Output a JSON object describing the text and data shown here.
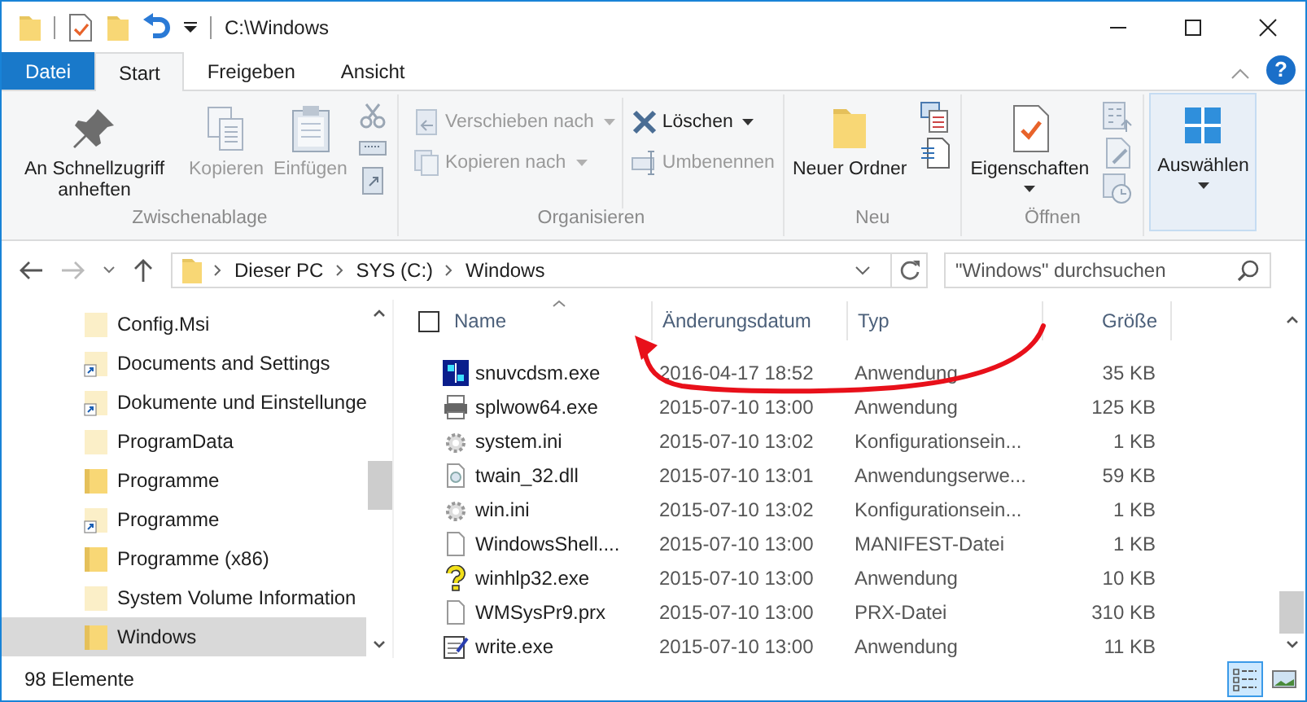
{
  "window": {
    "title": "C:\\Windows"
  },
  "tabs": [
    {
      "label": "Datei",
      "kind": "file"
    },
    {
      "label": "Start",
      "kind": "tab",
      "selected": true
    },
    {
      "label": "Freigeben",
      "kind": "tab",
      "selected": false
    },
    {
      "label": "Ansicht",
      "kind": "tab",
      "selected": false
    }
  ],
  "help": {
    "label": "?"
  },
  "ribbon": {
    "groups": [
      {
        "label": "Zwischenablage",
        "items": [
          {
            "kind": "large",
            "label": "An Schnellzugriff anheften",
            "disabled": false
          },
          {
            "kind": "large",
            "label": "Kopieren",
            "disabled": true
          },
          {
            "kind": "large",
            "label": "Einfügen",
            "disabled": true
          },
          {
            "kind": "icons"
          }
        ]
      },
      {
        "label": "Organisieren",
        "items": [
          {
            "kind": "column",
            "items": [
              {
                "label": "Verschieben nach",
                "disabled": true,
                "dropdown": true
              },
              {
                "label": "Kopieren nach",
                "disabled": true,
                "dropdown": true
              }
            ]
          },
          {
            "kind": "column",
            "items": [
              {
                "label": "Löschen",
                "disabled": false,
                "dropdown": true
              },
              {
                "label": "Umbenennen",
                "disabled": true,
                "dropdown": false
              }
            ]
          }
        ]
      },
      {
        "label": "Neu",
        "items": [
          {
            "kind": "large",
            "label": "Neuer Ordner",
            "disabled": false
          },
          {
            "kind": "icons"
          }
        ]
      },
      {
        "label": "Öffnen",
        "items": [
          {
            "kind": "large",
            "label": "Eigenschaften",
            "disabled": false,
            "dropdown": true
          },
          {
            "kind": "icons"
          }
        ]
      },
      {
        "items": [
          {
            "kind": "large",
            "label": "Auswählen",
            "disabled": false,
            "dropdown": true,
            "highlighted": true
          }
        ]
      }
    ]
  },
  "address": {
    "path": [
      "Dieser PC",
      "SYS (C:)",
      "Windows"
    ]
  },
  "search": {
    "placeholder": "\"Windows\" durchsuchen"
  },
  "nav": {
    "items": [
      {
        "label": "Config.Msi",
        "kind": "hidden",
        "selected": false
      },
      {
        "label": "Documents and Settings",
        "kind": "shortcut",
        "selected": false
      },
      {
        "label": "Dokumente und Einstellunge",
        "kind": "shortcut",
        "selected": false
      },
      {
        "label": "ProgramData",
        "kind": "hidden",
        "selected": false
      },
      {
        "label": "Programme",
        "kind": "folder",
        "selected": false
      },
      {
        "label": "Programme",
        "kind": "shortcut",
        "selected": false
      },
      {
        "label": "Programme (x86)",
        "kind": "folder",
        "selected": false
      },
      {
        "label": "System Volume Information",
        "kind": "hidden",
        "selected": false
      },
      {
        "label": "Windows",
        "kind": "folder",
        "selected": true
      }
    ]
  },
  "table": {
    "select_all": {
      "checked": false
    },
    "columns": [
      "Name",
      "Änderungsdatum",
      "Typ",
      "Größe"
    ],
    "rows": [
      {
        "name": "snuvcdsm.exe",
        "date": "2016-04-17 18:52",
        "type": "Anwendung",
        "size": "35 KB",
        "kind": "app"
      },
      {
        "name": "splwow64.exe",
        "date": "2015-07-10 13:00",
        "type": "Anwendung",
        "size": "125 KB",
        "kind": "printer"
      },
      {
        "name": "system.ini",
        "date": "2015-07-10 13:02",
        "type": "Konfigurationsein...",
        "size": "1 KB",
        "kind": "config"
      },
      {
        "name": "twain_32.dll",
        "date": "2015-07-10 13:01",
        "type": "Anwendungserwe...",
        "size": "59 KB",
        "kind": "dll"
      },
      {
        "name": "win.ini",
        "date": "2015-07-10 13:02",
        "type": "Konfigurationsein...",
        "size": "1 KB",
        "kind": "config"
      },
      {
        "name": "WindowsShell....",
        "date": "2015-07-10 13:00",
        "type": "MANIFEST-Datei",
        "size": "1 KB",
        "kind": "file"
      },
      {
        "name": "winhlp32.exe",
        "date": "2015-07-10 13:00",
        "type": "Anwendung",
        "size": "10 KB",
        "kind": "help"
      },
      {
        "name": "WMSysPr9.prx",
        "date": "2015-07-10 13:00",
        "type": "PRX-Datei",
        "size": "310 KB",
        "kind": "file"
      },
      {
        "name": "write.exe",
        "date": "2015-07-10 13:00",
        "type": "Anwendung",
        "size": "11 KB",
        "kind": "write"
      }
    ]
  },
  "status_bar": {
    "count": "98 Elemente"
  }
}
